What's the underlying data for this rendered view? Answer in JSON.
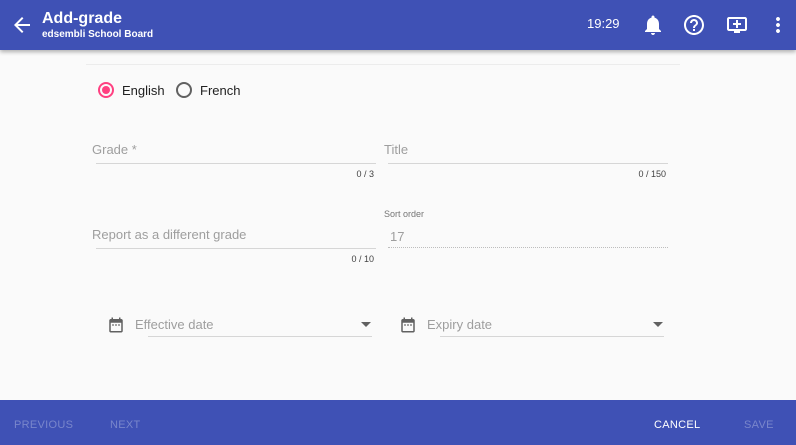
{
  "header": {
    "title": "Add-grade",
    "subtitle": "edsembli School Board",
    "time": "19:29",
    "background": "#3f51b5"
  },
  "icons": {
    "back": "arrow-back-icon",
    "notifications": "bell-icon",
    "help": "help-icon",
    "screen": "screen-share-icon",
    "menu": "more-vert-icon",
    "calendar": "calendar-icon",
    "dropdown": "chevron-down-icon"
  },
  "language": {
    "options": [
      "English",
      "French"
    ],
    "selected": "English",
    "accent": "#ff4081"
  },
  "form": {
    "grade": {
      "label": "Grade *",
      "value": "",
      "counter": "0 / 3"
    },
    "title": {
      "label": "Title",
      "value": "",
      "counter": "0 / 150"
    },
    "report_as": {
      "label": "Report as a different grade",
      "value": "",
      "counter": "0 / 10"
    },
    "sort_order": {
      "label": "Sort order",
      "value": "17"
    },
    "effective_date": {
      "label": "Effective date",
      "value": ""
    },
    "expiry_date": {
      "label": "Expiry date",
      "value": ""
    }
  },
  "footer": {
    "previous": "PREVIOUS",
    "next": "NEXT",
    "cancel": "CANCEL",
    "save": "SAVE"
  }
}
